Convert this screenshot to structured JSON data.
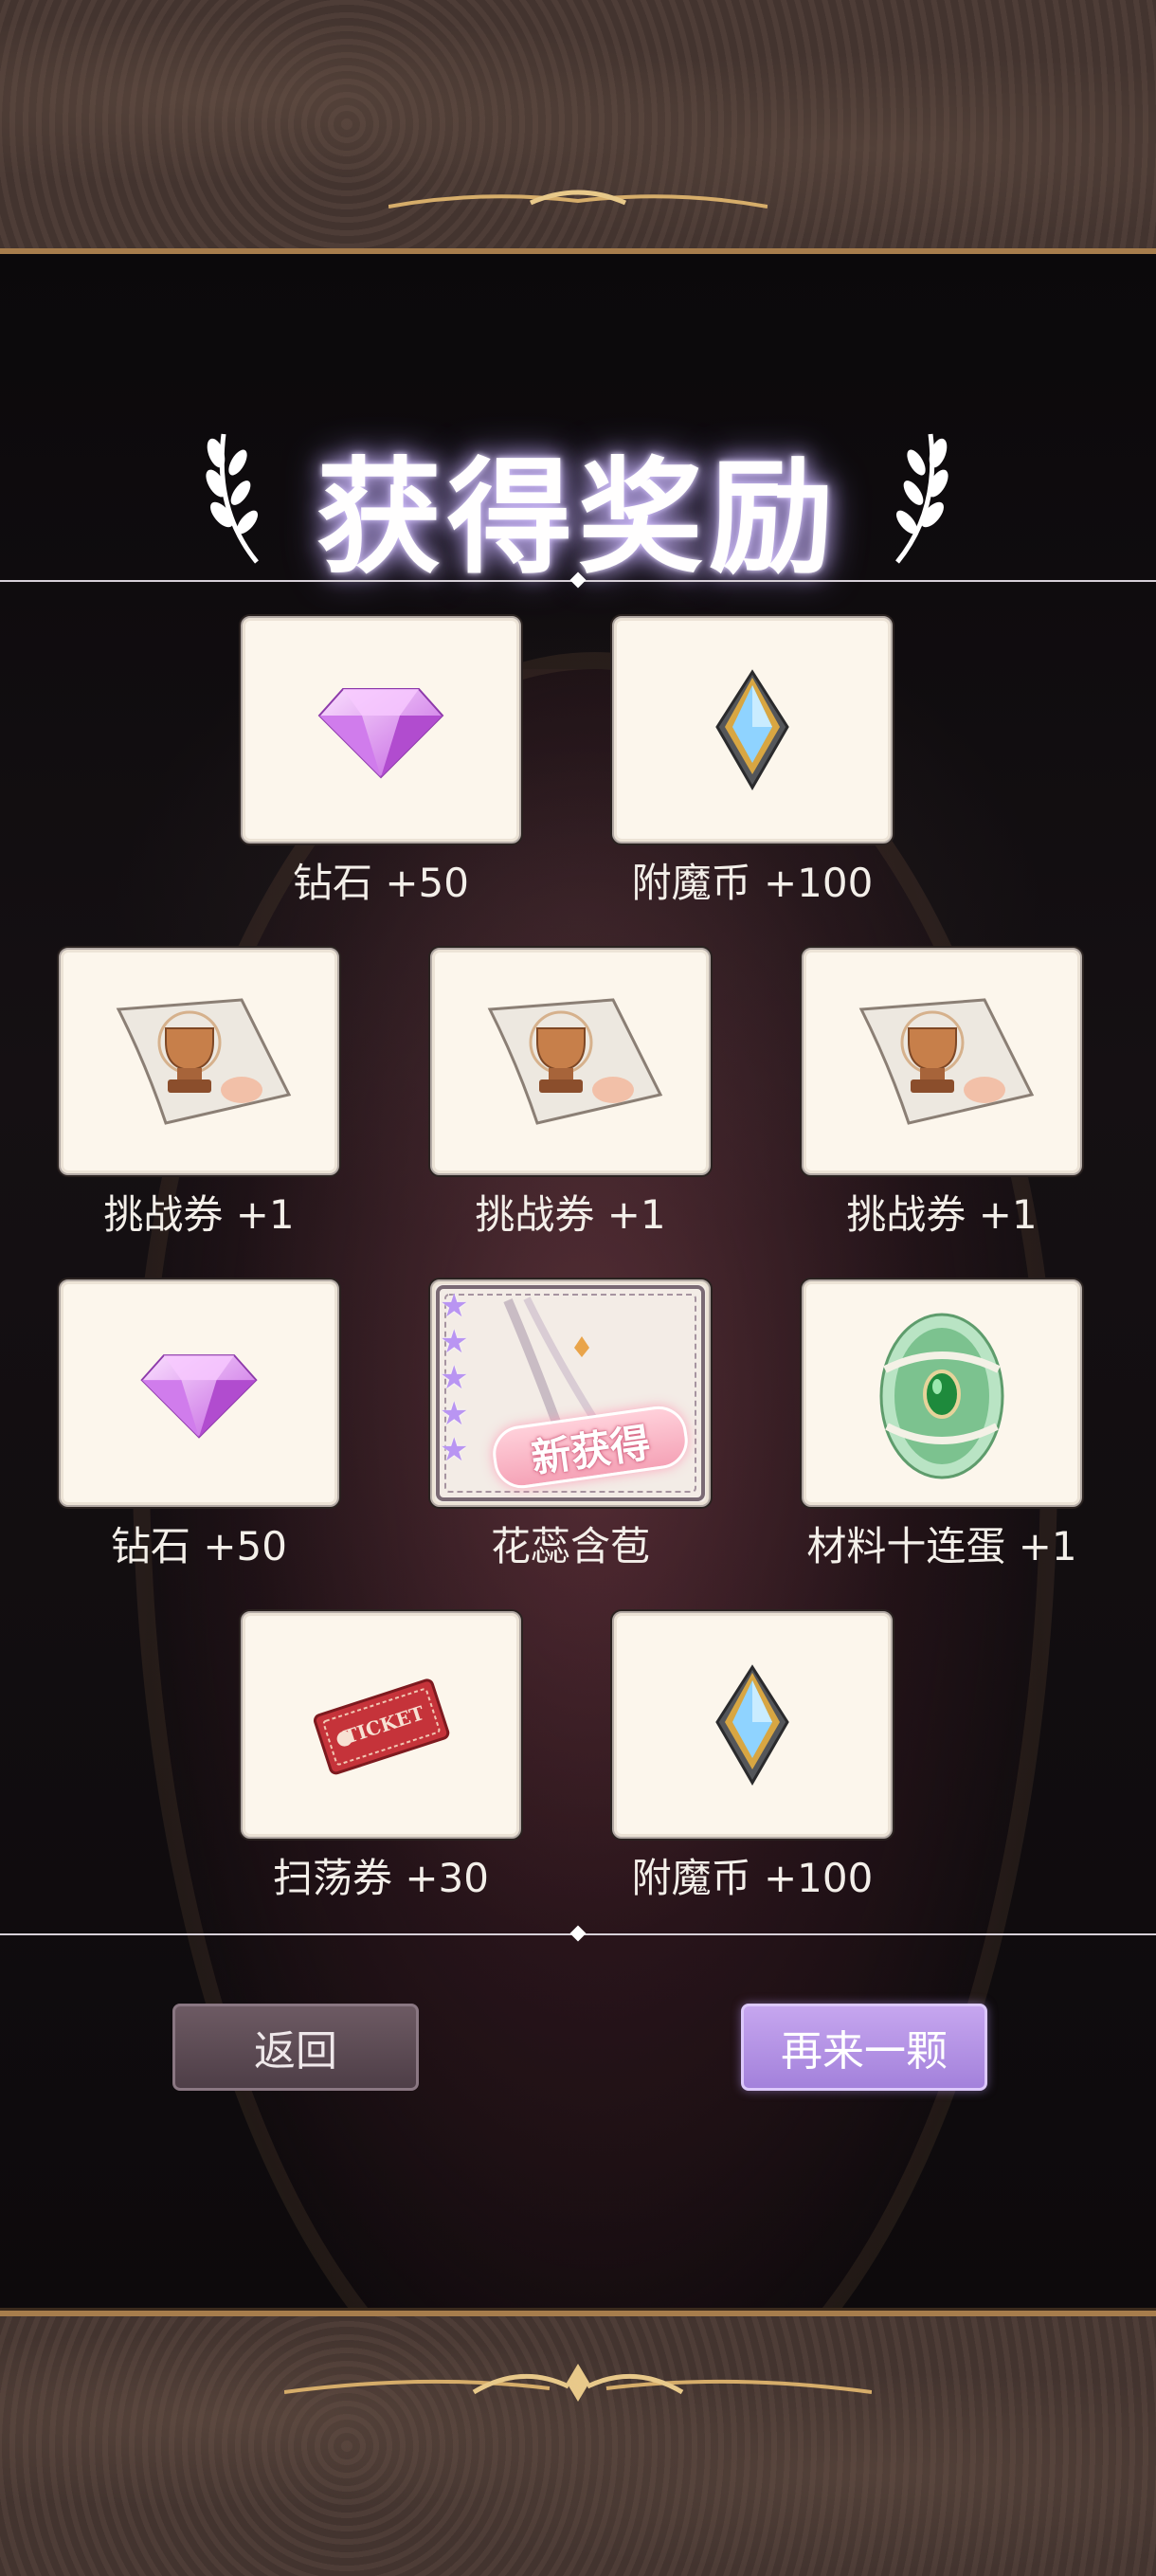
{
  "title": "获得奖励",
  "rewards": [
    {
      "name": "钻石 +50",
      "icon": "diamond-icon"
    },
    {
      "name": "附魔币 +100",
      "icon": "enchant-coin-icon"
    },
    {
      "name": "挑战券 +1",
      "icon": "challenge-ticket-icon"
    },
    {
      "name": "挑战券 +1",
      "icon": "challenge-ticket-icon"
    },
    {
      "name": "挑战券 +1",
      "icon": "challenge-ticket-icon"
    },
    {
      "name": "钻石 +50",
      "icon": "diamond-icon"
    },
    {
      "name": "花蕊含苞",
      "icon": "card-art",
      "new": true,
      "new_label": "新获得",
      "stars": 5
    },
    {
      "name": "材料十连蛋 +1",
      "icon": "green-egg-icon"
    },
    {
      "name": "扫荡券 +30",
      "icon": "sweep-ticket-icon",
      "ticket_text": "TICKET"
    },
    {
      "name": "附魔币 +100",
      "icon": "enchant-coin-icon"
    }
  ],
  "buttons": {
    "back": "返回",
    "again": "再来一颗"
  },
  "colors": {
    "accent": "#b28ae8",
    "card_bg": "#fcf6ec",
    "frame_gold": "#a77d4c"
  }
}
